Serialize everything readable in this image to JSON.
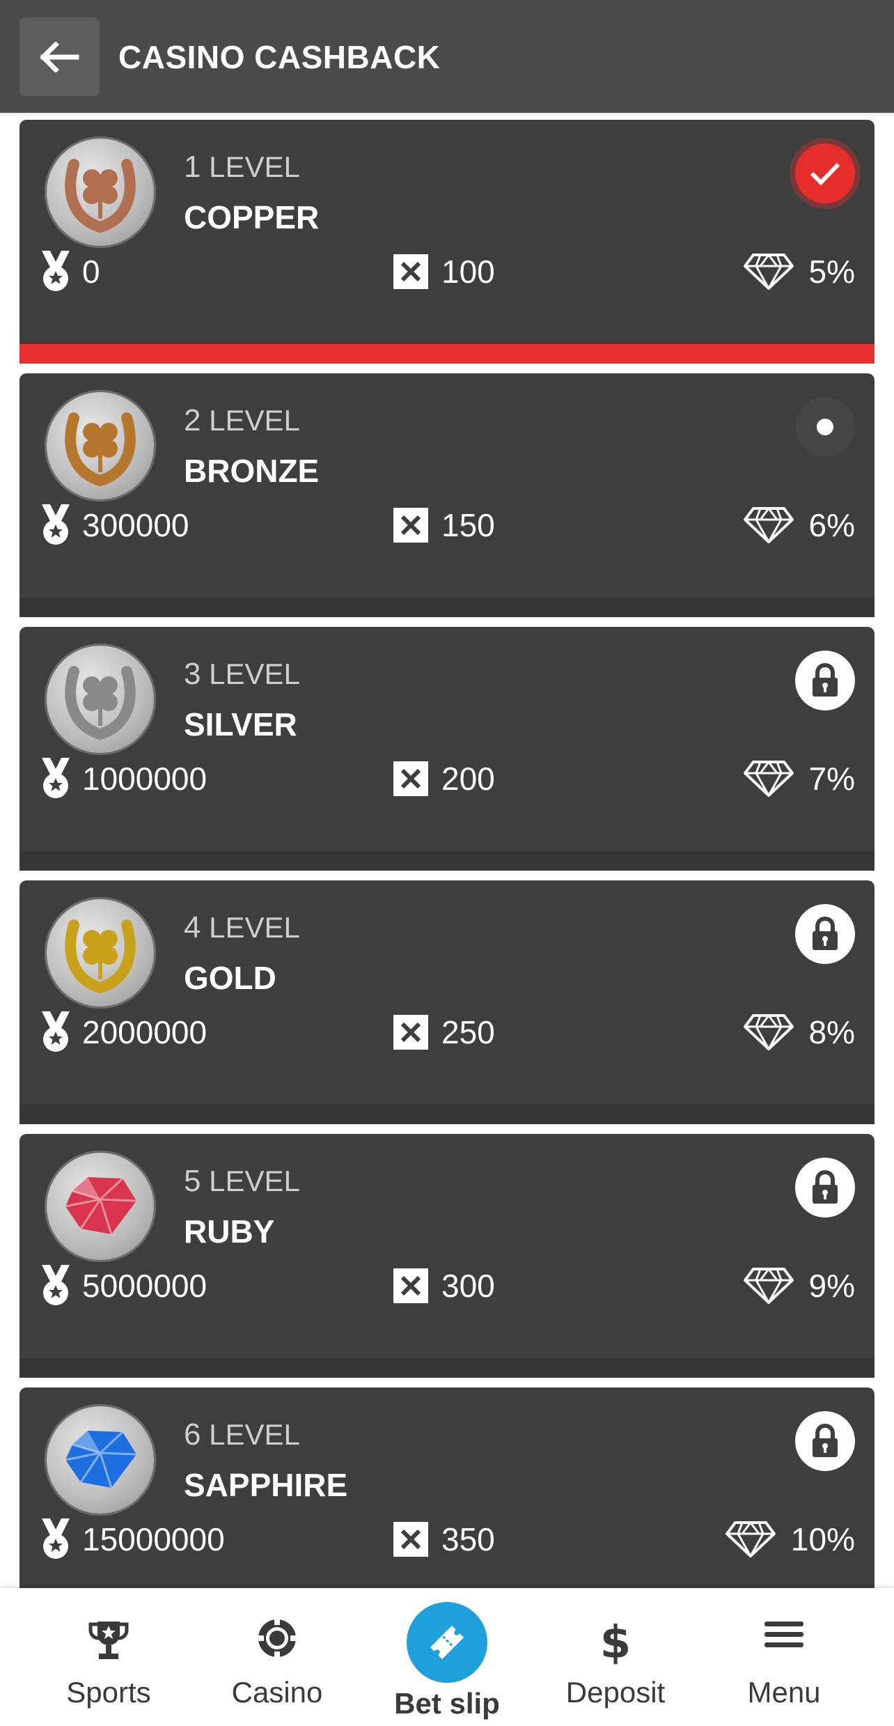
{
  "header": {
    "title": "CASINO CASHBACK",
    "back_icon": "arrow-left-icon"
  },
  "level_word": "LEVEL",
  "levels": [
    {
      "num": "1",
      "name": "COPPER",
      "points": "0",
      "multiplier": "100",
      "cashback": "5%",
      "status": "completed",
      "emblem": "copper-horseshoe-clover",
      "emblem_color": "#b0704f"
    },
    {
      "num": "2",
      "name": "BRONZE",
      "points": "300000",
      "multiplier": "150",
      "cashback": "6%",
      "status": "current",
      "emblem": "bronze-horseshoe-clover",
      "emblem_color": "#b5762e"
    },
    {
      "num": "3",
      "name": "SILVER",
      "points": "1000000",
      "multiplier": "200",
      "cashback": "7%",
      "status": "locked",
      "emblem": "silver-horseshoe-clover",
      "emblem_color": "#8a8a8a"
    },
    {
      "num": "4",
      "name": "GOLD",
      "points": "2000000",
      "multiplier": "250",
      "cashback": "8%",
      "status": "locked",
      "emblem": "gold-horseshoe-clover",
      "emblem_color": "#c9a21c"
    },
    {
      "num": "5",
      "name": "RUBY",
      "points": "5000000",
      "multiplier": "300",
      "cashback": "9%",
      "status": "locked",
      "emblem": "ruby-gem",
      "emblem_color": "#d8344e"
    },
    {
      "num": "6",
      "name": "SAPPHIRE",
      "points": "15000000",
      "multiplier": "350",
      "cashback": "10%",
      "status": "locked",
      "emblem": "sapphire-gem",
      "emblem_color": "#1d6fe0"
    }
  ],
  "nav": {
    "sports": "Sports",
    "casino": "Casino",
    "bet_slip": "Bet slip",
    "deposit": "Deposit",
    "menu": "Menu"
  },
  "colors": {
    "header_bg": "#4a4a4a",
    "card_bg": "#3e3e3e",
    "active_accent": "#e8302e",
    "bet_slip_accent": "#1f9fdc"
  }
}
